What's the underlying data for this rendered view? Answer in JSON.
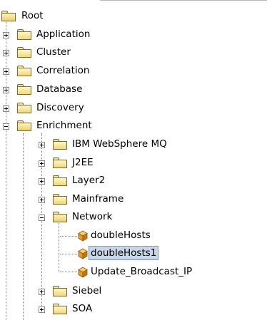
{
  "tree": {
    "root": "Root",
    "top_level": [
      "Application",
      "Cluster",
      "Correlation",
      "Database",
      "Discovery",
      "Enrichment"
    ],
    "enrichment_children": [
      "IBM WebSphere MQ",
      "J2EE",
      "Layer2",
      "Mainframe",
      "Network",
      "Siebel",
      "SOA"
    ],
    "network_children": [
      "doubleHosts",
      "doubleHosts1",
      "Update_Broadcast_IP"
    ],
    "selected": "doubleHosts1"
  },
  "colors": {
    "selection": "#c8d6e8",
    "folder": "#f0d77a",
    "cube": "#e09a30"
  },
  "icons": {
    "folder": "folder-icon",
    "open_folder": "open-folder-icon",
    "item": "cube-icon",
    "expand": "plus-icon",
    "collapse": "minus-icon"
  }
}
